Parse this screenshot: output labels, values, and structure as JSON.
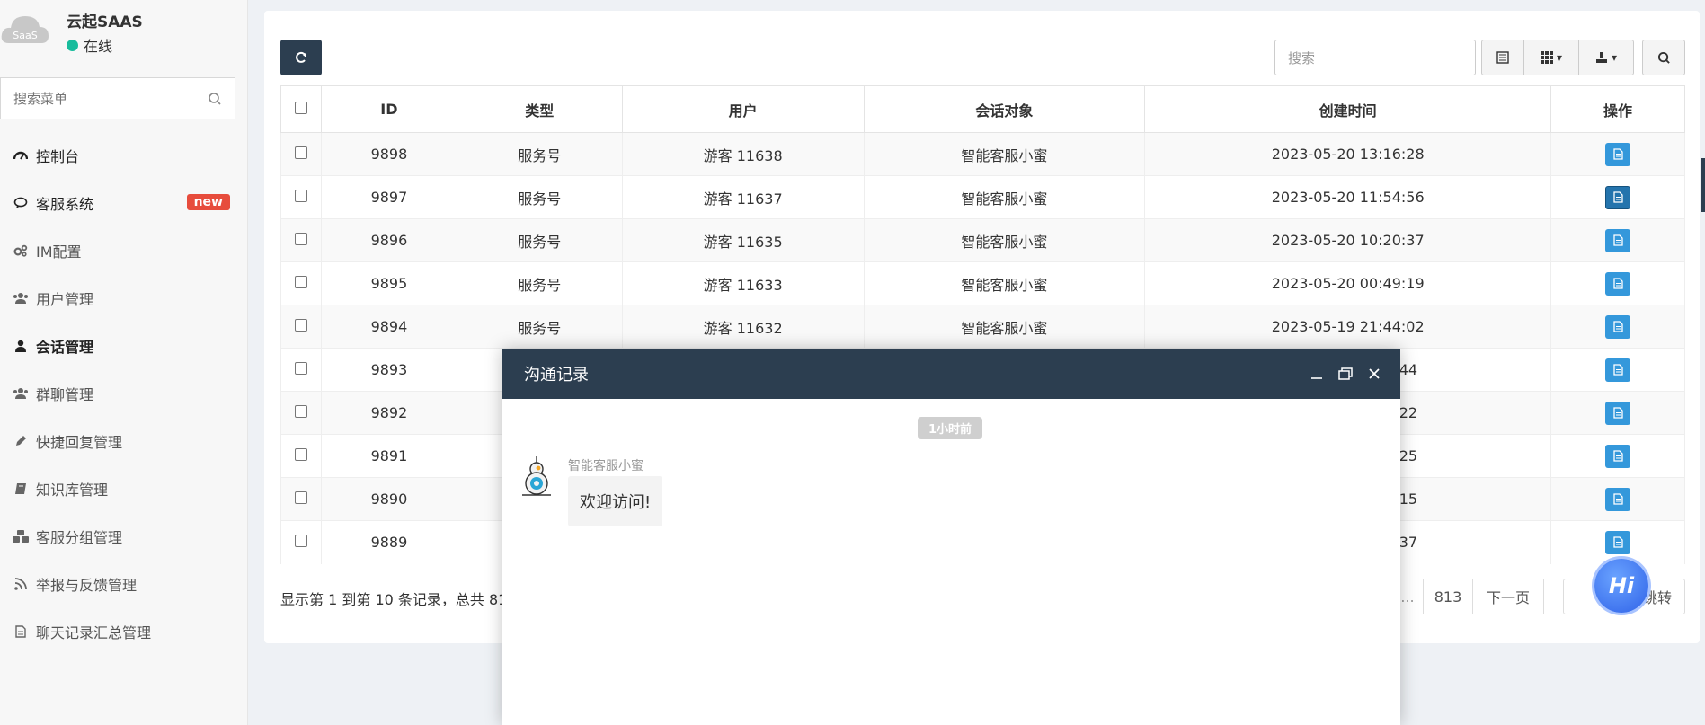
{
  "brand": {
    "name": "云起SAAS",
    "status": "在线",
    "logo_text": "SaaS"
  },
  "sidebar": {
    "search_placeholder": "搜索菜单",
    "items": [
      {
        "label": "控制台",
        "icon": "dashboard-icon"
      },
      {
        "label": "客服系统",
        "icon": "comment-icon",
        "badge": "new"
      },
      {
        "label": "IM配置",
        "icon": "cogs-icon"
      },
      {
        "label": "用户管理",
        "icon": "users-icon"
      },
      {
        "label": "会话管理",
        "icon": "user-icon",
        "active": true
      },
      {
        "label": "群聊管理",
        "icon": "users-icon"
      },
      {
        "label": "快捷回复管理",
        "icon": "pencil-icon"
      },
      {
        "label": "知识库管理",
        "icon": "book-icon"
      },
      {
        "label": "客服分组管理",
        "icon": "cubes-icon"
      },
      {
        "label": "举报与反馈管理",
        "icon": "rss-icon"
      },
      {
        "label": "聊天记录汇总管理",
        "icon": "file-icon"
      }
    ]
  },
  "toolbar": {
    "search_placeholder": "搜索"
  },
  "table": {
    "headers": [
      "ID",
      "类型",
      "用户",
      "会话对象",
      "创建时间",
      "操作"
    ],
    "rows": [
      {
        "id": "9898",
        "type": "服务号",
        "user": "游客 11638",
        "target": "智能客服小蜜",
        "time": "2023-05-20 13:16:28"
      },
      {
        "id": "9897",
        "type": "服务号",
        "user": "游客 11637",
        "target": "智能客服小蜜",
        "time": "2023-05-20 11:54:56"
      },
      {
        "id": "9896",
        "type": "服务号",
        "user": "游客 11635",
        "target": "智能客服小蜜",
        "time": "2023-05-20 10:20:37"
      },
      {
        "id": "9895",
        "type": "服务号",
        "user": "游客 11633",
        "target": "智能客服小蜜",
        "time": "2023-05-20 00:49:19"
      },
      {
        "id": "9894",
        "type": "服务号",
        "user": "游客 11632",
        "target": "智能客服小蜜",
        "time": "2023-05-19 21:44:02"
      },
      {
        "id": "9893",
        "type": "",
        "user": "",
        "target": "",
        "time": "44"
      },
      {
        "id": "9892",
        "type": "",
        "user": "",
        "target": "",
        "time": "22"
      },
      {
        "id": "9891",
        "type": "",
        "user": "",
        "target": "",
        "time": "25"
      },
      {
        "id": "9890",
        "type": "",
        "user": "",
        "target": "",
        "time": "15"
      },
      {
        "id": "9889",
        "type": "",
        "user": "",
        "target": "",
        "time": "37"
      }
    ]
  },
  "footer": {
    "info": "显示第 1 到第 10 条记录，总共 81"
  },
  "pagination": {
    "dots": "...",
    "last_page": "813",
    "next": "下一页",
    "jump": "跳转"
  },
  "dialog": {
    "title": "沟通记录",
    "time_label": "1小时前",
    "sender": "智能客服小蜜",
    "message": "欢迎访问!"
  },
  "float_button": {
    "label": "Hi"
  }
}
